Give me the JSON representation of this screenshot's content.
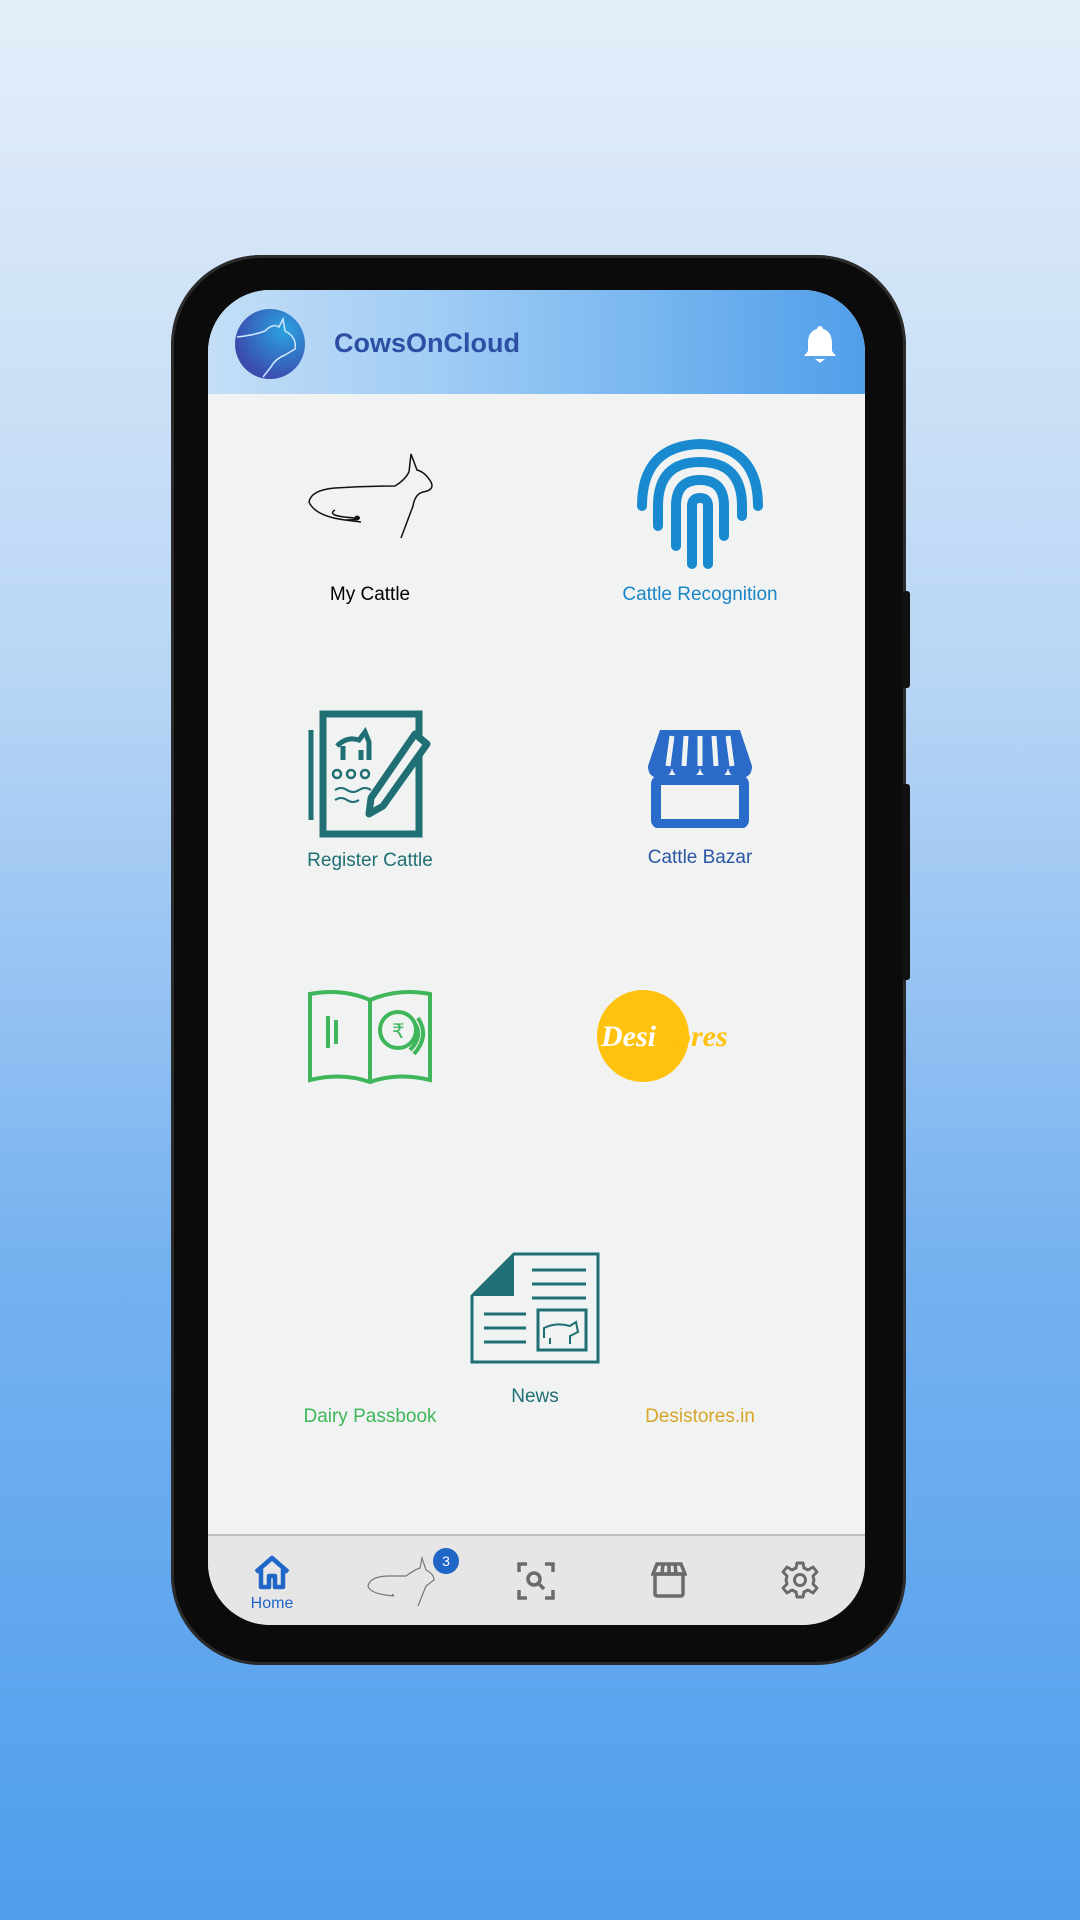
{
  "app": {
    "title": "CowsOnCloud",
    "notification_icon": "bell-icon"
  },
  "tiles": [
    {
      "label": "My Cattle",
      "color": "#111111",
      "icon": "cow-outline-icon"
    },
    {
      "label": "Cattle Recognition",
      "color": "#1a86c8",
      "icon": "fingerprint-icon"
    },
    {
      "label": "Register Cattle",
      "color": "#1f6f74",
      "icon": "register-form-icon"
    },
    {
      "label": "Cattle Bazar",
      "color": "#2a56a3",
      "icon": "storefront-icon"
    },
    {
      "label": "Dairy Passbook",
      "color": "#3fb65a",
      "icon": "passbook-icon"
    },
    {
      "label": "Desistores.in",
      "color": "#d8a52a",
      "icon": "desistores-logo"
    },
    {
      "label": "News",
      "color": "#1f6f74",
      "icon": "newspaper-icon"
    }
  ],
  "desistores_logo_text": "Desistores",
  "nav": {
    "items": [
      {
        "label": "Home",
        "icon": "home-icon",
        "active": true
      },
      {
        "icon": "cattle-icon",
        "badge": "3"
      },
      {
        "icon": "scan-search-icon"
      },
      {
        "icon": "store-icon"
      },
      {
        "icon": "gear-icon"
      }
    ]
  },
  "colors": {
    "accent": "#1f66c6",
    "header_title": "#2c4fa3",
    "inactive_icon": "#6b6b6b"
  }
}
